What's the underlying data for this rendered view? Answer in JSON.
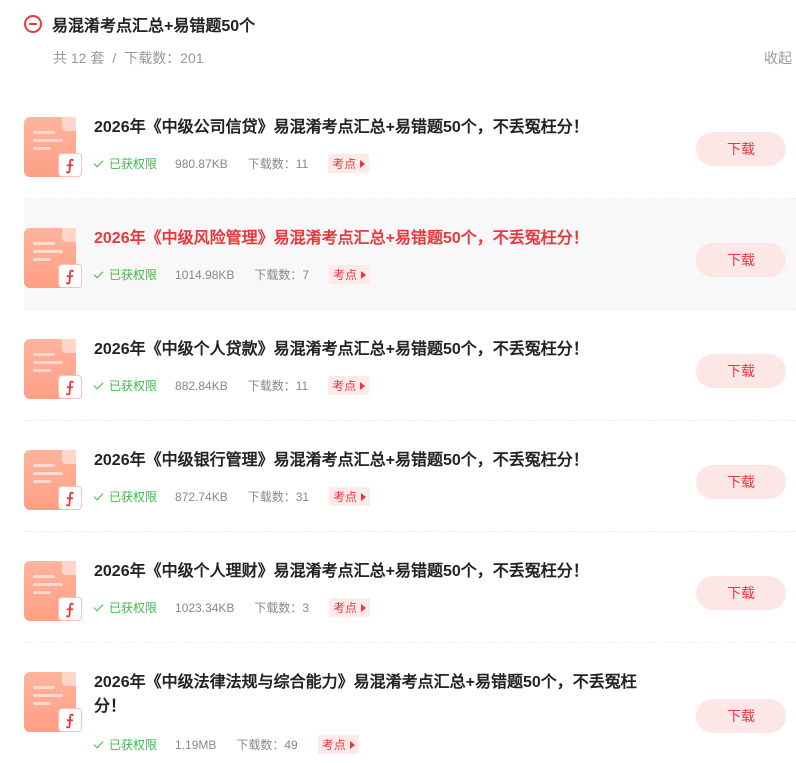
{
  "group": {
    "title": "易混淆考点汇总+易错题50个",
    "count_text": "共 12 套",
    "separator": "/",
    "downloads_text": "下载数：201",
    "collapse_label": "收起"
  },
  "items": [
    {
      "title": "2026年《中级公司信贷》易混淆考点汇总+易错题50个，不丢冤枉分！",
      "permission": "已获权限",
      "size": "980.87KB",
      "downloads": "下载数：11",
      "tag": "考点",
      "button": "下载"
    },
    {
      "title": "2026年《中级风险管理》易混淆考点汇总+易错题50个，不丢冤枉分！",
      "permission": "已获权限",
      "size": "1014.98KB",
      "downloads": "下载数：7",
      "tag": "考点",
      "button": "下载"
    },
    {
      "title": "2026年《中级个人贷款》易混淆考点汇总+易错题50个，不丢冤枉分！",
      "permission": "已获权限",
      "size": "882.84KB",
      "downloads": "下载数：11",
      "tag": "考点",
      "button": "下载"
    },
    {
      "title": "2026年《中级银行管理》易混淆考点汇总+易错题50个，不丢冤枉分！",
      "permission": "已获权限",
      "size": "872.74KB",
      "downloads": "下载数：31",
      "tag": "考点",
      "button": "下载"
    },
    {
      "title": "2026年《中级个人理财》易混淆考点汇总+易错题50个，不丢冤枉分！",
      "permission": "已获权限",
      "size": "1023.34KB",
      "downloads": "下载数：3",
      "tag": "考点",
      "button": "下载"
    },
    {
      "title": "2026年《中级法律法规与综合能力》易混淆考点汇总+易错题50个，不丢冤枉分！",
      "permission": "已获权限",
      "size": "1.19MB",
      "downloads": "下载数：49",
      "tag": "考点",
      "button": "下载"
    }
  ],
  "icons": {
    "collapse": "minus-circle-icon",
    "file": "pdf-file-icon",
    "check": "check-icon",
    "tag_arrow": "play-triangle-icon"
  },
  "colors": {
    "accent": "#e8383d",
    "success": "#3fb94e",
    "button_bg": "#fde6e6",
    "file_icon": "#ff9e85"
  }
}
